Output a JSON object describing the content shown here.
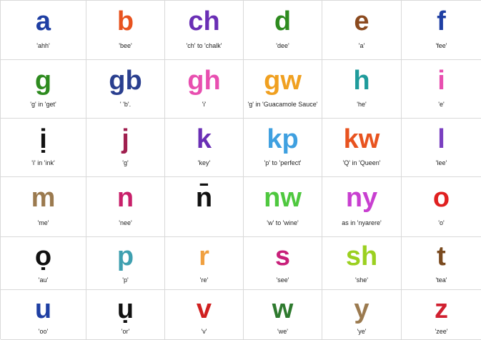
{
  "cells": [
    {
      "letter": "a",
      "hint": "'ahh'",
      "color": "#1f3fa3"
    },
    {
      "letter": "b",
      "hint": "'bee'",
      "color": "#e8531f"
    },
    {
      "letter": "ch",
      "hint": "'ch' to 'chalk'",
      "color": "#6a2fb5"
    },
    {
      "letter": "d",
      "hint": "'dee'",
      "color": "#2e8b1f"
    },
    {
      "letter": "e",
      "hint": "'a'",
      "color": "#8b4a1f"
    },
    {
      "letter": "f",
      "hint": "'fee'",
      "color": "#1f3fa3"
    },
    {
      "letter": "g",
      "hint": "'g' in 'get'",
      "color": "#2e8b1f"
    },
    {
      "letter": "gb",
      "hint": "' 'b'.",
      "color": "#2a3f8f"
    },
    {
      "letter": "gh",
      "hint": "'i'",
      "color": "#e84fb0"
    },
    {
      "letter": "gw",
      "hint": "'g' in 'Guacamole Sauce'",
      "color": "#f0a020"
    },
    {
      "letter": "h",
      "hint": "'he'",
      "color": "#1f9b9b"
    },
    {
      "letter": "i",
      "hint": "'e'",
      "color": "#e84fb0"
    },
    {
      "letter": "ị",
      "hint": "'i' in 'ink'",
      "color": "#111111"
    },
    {
      "letter": "j",
      "hint": "'g'",
      "color": "#a01f4f"
    },
    {
      "letter": "k",
      "hint": "'key'",
      "color": "#6a2fb5"
    },
    {
      "letter": "kp",
      "hint": "'p' to 'perfect'",
      "color": "#3fa0e0"
    },
    {
      "letter": "kw",
      "hint": "'Q' in 'Queen'",
      "color": "#e8531f"
    },
    {
      "letter": "l",
      "hint": "'lee'",
      "color": "#7a3fc0"
    },
    {
      "letter": "m",
      "hint": "'me'",
      "color": "#9b7a4f"
    },
    {
      "letter": "n",
      "hint": "'nee'",
      "color": "#c8206a"
    },
    {
      "letter": "n̄",
      "hint": "",
      "color": "#111111"
    },
    {
      "letter": "nw",
      "hint": "'w' to 'wine'",
      "color": "#4fc83f"
    },
    {
      "letter": "ny",
      "hint": "as in 'nyarere'",
      "color": "#c83fd0"
    },
    {
      "letter": "o",
      "hint": "'o'",
      "color": "#e02020"
    },
    {
      "letter": "ọ",
      "hint": "'au'",
      "color": "#111111"
    },
    {
      "letter": "p",
      "hint": "'p'",
      "color": "#3fa0b0"
    },
    {
      "letter": "r",
      "hint": "'re'",
      "color": "#f0a040"
    },
    {
      "letter": "s",
      "hint": "'see'",
      "color": "#c8207a"
    },
    {
      "letter": "sh",
      "hint": "'she'",
      "color": "#9bd020"
    },
    {
      "letter": "t",
      "hint": "'tea'",
      "color": "#7a4a1f"
    },
    {
      "letter": "u",
      "hint": "'oo'",
      "color": "#1f3fa3"
    },
    {
      "letter": "ụ",
      "hint": "'or'",
      "color": "#111111"
    },
    {
      "letter": "v",
      "hint": "'v'",
      "color": "#d02020"
    },
    {
      "letter": "w",
      "hint": "'we'",
      "color": "#2e7a2e"
    },
    {
      "letter": "y",
      "hint": "'ye'",
      "color": "#9b7a4f"
    },
    {
      "letter": "z",
      "hint": "'zee'",
      "color": "#d02030"
    }
  ]
}
